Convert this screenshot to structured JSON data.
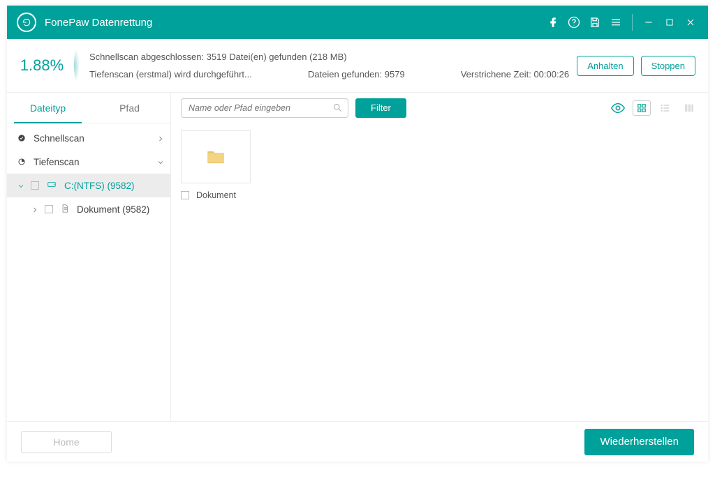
{
  "titlebar": {
    "title": "FonePaw Datenrettung"
  },
  "progress": {
    "percent": "1.88%",
    "line1": "Schnellscan abgeschlossen: 3519 Datei(en) gefunden (218 MB)",
    "deep_line": "Tiefenscan (erstmal) wird durchgeführt...",
    "found_label": "Dateien gefunden: 9579",
    "elapsed_label": "Verstrichene Zeit: 00:00:26",
    "pause": "Anhalten",
    "stop": "Stoppen"
  },
  "sidebar": {
    "tabs": {
      "type": "Dateityp",
      "path": "Pfad"
    },
    "quick": "Schnellscan",
    "deep": "Tiefenscan",
    "drive": "C:(NTFS) (9582)",
    "doc": "Dokument (9582)"
  },
  "toolbar": {
    "search_placeholder": "Name oder Pfad eingeben",
    "filter": "Filter"
  },
  "grid": {
    "folder_label": "Dokument"
  },
  "footer": {
    "home": "Home",
    "recover": "Wiederherstellen"
  }
}
